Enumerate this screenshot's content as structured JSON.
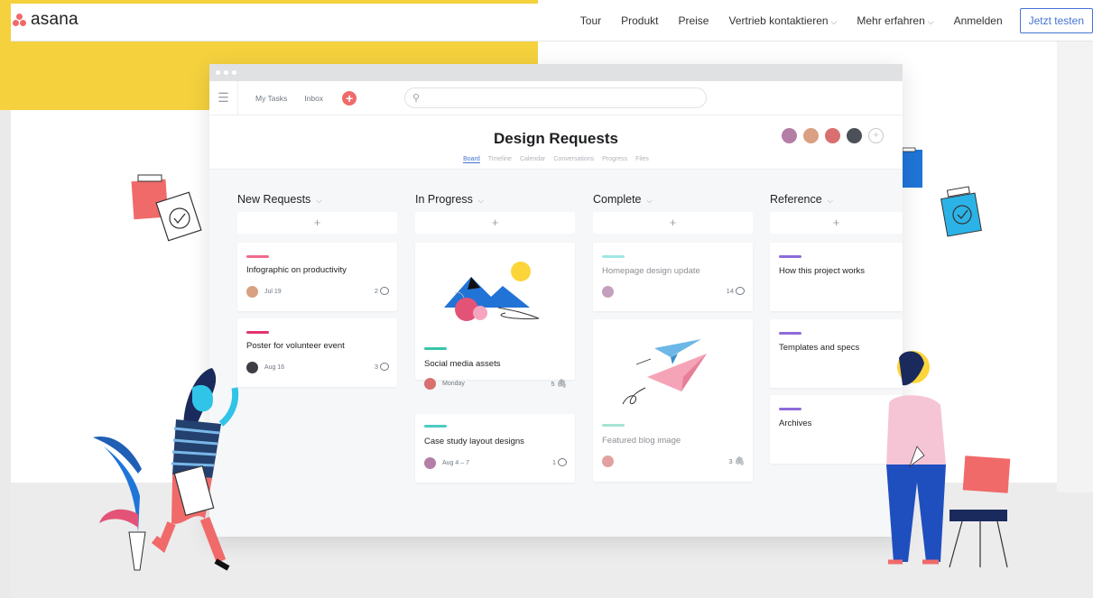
{
  "brand": {
    "name": "asana"
  },
  "nav": {
    "links": [
      "Tour",
      "Produkt",
      "Preise",
      "Vertrieb kontaktieren",
      "Mehr erfahren",
      "Anmelden"
    ],
    "cta": "Jetzt testen"
  },
  "app": {
    "toplinks": [
      "My Tasks",
      "Inbox"
    ],
    "project_title": "Design Requests",
    "tabs": [
      "Board",
      "Timeline",
      "Calendar",
      "Conversations",
      "Progress",
      "Files"
    ],
    "active_tab": "Board",
    "columns": [
      {
        "title": "New Requests",
        "cards": [
          {
            "title": "Infographic on productivity",
            "date": "Jul 19",
            "count": "2",
            "tag_color": "#f06a8a",
            "icon": "comment-icon"
          },
          {
            "title": "Poster for volunteer event",
            "date": "Aug 16",
            "count": "3",
            "tag_color": "#e3326f",
            "icon": "comment-icon"
          }
        ]
      },
      {
        "title": "In Progress",
        "cards": [
          {
            "title": "Social media assets",
            "date": "Monday",
            "count": "5",
            "tag_color": "#37c5ab",
            "icon": "attachment-icon"
          },
          {
            "title": "Case study layout designs",
            "date": "Aug 4 – 7",
            "count": "1",
            "tag_color": "#4ecbc4",
            "icon": "comment-icon"
          }
        ]
      },
      {
        "title": "Complete",
        "cards": [
          {
            "title": "Homepage design update",
            "date": "",
            "count": "14",
            "tag_color": "#9ee7e3",
            "icon": "comment-icon"
          },
          {
            "title": "Featured blog image",
            "date": "",
            "count": "3",
            "tag_color": "#a6e3d6",
            "icon": "attachment-icon"
          }
        ]
      },
      {
        "title": "Reference",
        "cards": [
          {
            "title": "How this project works",
            "tag_color": "#8d6bd9"
          },
          {
            "title": "Templates and specs",
            "tag_color": "#8d6bd9"
          },
          {
            "title": "Archives",
            "tag_color": "#8d6bd9"
          }
        ]
      }
    ]
  },
  "colors": {
    "accent": "#4573d2",
    "brand_coral": "#f06a6a",
    "yellow": "#f4d13d"
  }
}
